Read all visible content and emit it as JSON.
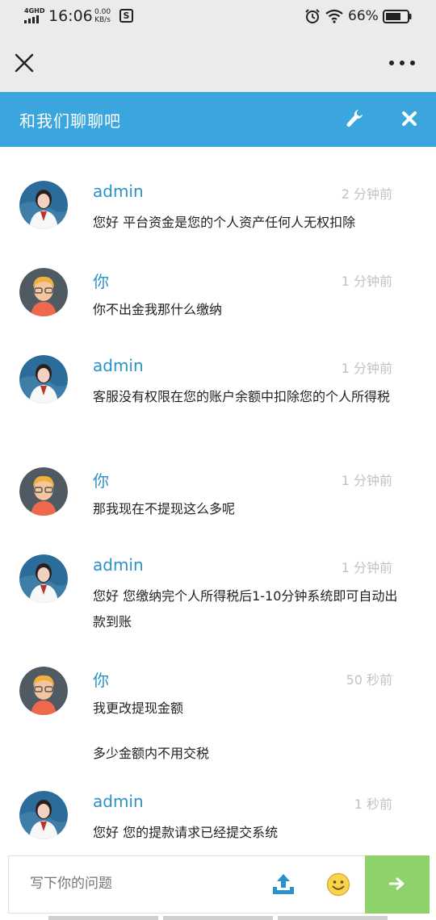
{
  "status_bar": {
    "network": "4GHD",
    "time": "16:06",
    "speed_value": "0.00",
    "speed_unit": "KB/s",
    "notification_glyph": "S",
    "battery": "66%",
    "icons": [
      "signal-icon",
      "notification-icon",
      "alarm-icon",
      "wifi-icon",
      "battery-icon"
    ]
  },
  "browser_bar": {
    "icons": [
      "close-icon",
      "more-icon"
    ]
  },
  "chat": {
    "title": "和我们聊聊吧",
    "header_icons": [
      "wrench-icon",
      "close-icon"
    ],
    "accent_color": "#3ba6dd",
    "messages": [
      {
        "sender": "admin",
        "role": "admin",
        "time": "2 分钟前",
        "lines": [
          "您好 平台资金是您的个人资产任何人无权扣除"
        ]
      },
      {
        "sender": "你",
        "role": "user",
        "time": "1 分钟前",
        "lines": [
          "你不出金我那什么缴纳"
        ]
      },
      {
        "sender": "admin",
        "role": "admin",
        "time": "1 分钟前",
        "lines": [
          "客服没有权限在您的账户余额中扣除您的个人所得税"
        ]
      },
      {
        "sender": "你",
        "role": "user",
        "time": "1 分钟前",
        "lines": [
          "那我现在不提现这么多呢"
        ]
      },
      {
        "sender": "admin",
        "role": "admin",
        "time": "1 分钟前",
        "lines": [
          "您好 您缴纳完个人所得税后1-10分钟系统即可自动出款到账"
        ]
      },
      {
        "sender": "你",
        "role": "user",
        "time": "50 秒前",
        "lines": [
          "我更改提现金额",
          "多少金额内不用交税"
        ]
      },
      {
        "sender": "admin",
        "role": "admin",
        "time": "1 秒前",
        "lines": [
          "您好 您的提款请求已经提交系统"
        ]
      }
    ]
  },
  "composer": {
    "placeholder": "写下你的问题",
    "icons": [
      "upload-icon",
      "smile-icon",
      "arrow-right-icon"
    ],
    "send_color": "#8fd16a"
  }
}
